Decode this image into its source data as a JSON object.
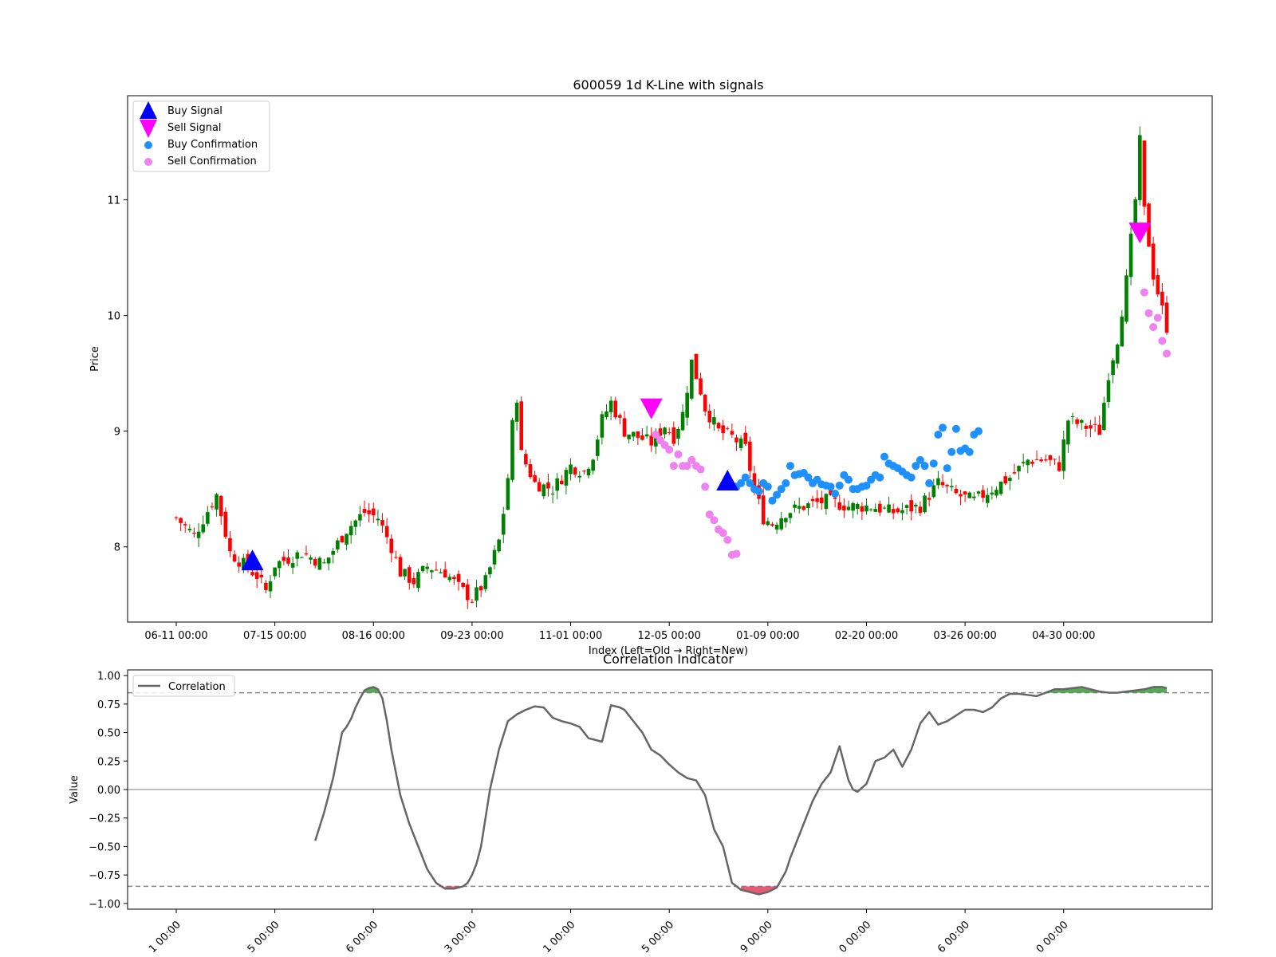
{
  "chart_data": [
    {
      "type": "candlestick",
      "title": "600059 1d K-Line with signals",
      "xlabel": "Index (Left=Old → Right=New)",
      "ylabel": "Price",
      "ylim": [
        7.35,
        11.9
      ],
      "yticks": [
        8,
        9,
        10,
        11
      ],
      "xtick_labels": [
        "06-11 00:00",
        "07-15 00:00",
        "08-16 00:00",
        "09-23 00:00",
        "11-01 00:00",
        "12-05 00:00",
        "01-09 00:00",
        "02-20 00:00",
        "03-26 00:00",
        "04-30 00:00"
      ],
      "xtick_index": [
        0,
        22,
        44,
        66,
        88,
        110,
        132,
        154,
        176,
        198
      ],
      "n_bars": 222,
      "legend": {
        "position": "upper left",
        "entries": [
          "Buy Signal",
          "Sell Signal",
          "Buy Confirmation",
          "Sell Confirmation"
        ]
      },
      "colors": {
        "up": "#008000",
        "down": "#ff0000",
        "buy_signal": "#0000ff",
        "sell_signal": "#ff00ff",
        "buy_confirmation": "#1e90ff",
        "sell_confirmation": "#ee82ee"
      },
      "close_anchors": [
        [
          0,
          8.25
        ],
        [
          4,
          8.1
        ],
        [
          9,
          8.45
        ],
        [
          12,
          7.95
        ],
        [
          18,
          7.75
        ],
        [
          20,
          7.62
        ],
        [
          22,
          7.85
        ],
        [
          28,
          7.95
        ],
        [
          33,
          7.85
        ],
        [
          38,
          8.15
        ],
        [
          42,
          8.3
        ],
        [
          45,
          8.25
        ],
        [
          48,
          8.0
        ],
        [
          50,
          7.78
        ],
        [
          53,
          7.7
        ],
        [
          56,
          7.83
        ],
        [
          60,
          7.78
        ],
        [
          63,
          7.65
        ],
        [
          66,
          7.55
        ],
        [
          69,
          7.7
        ],
        [
          72,
          8.05
        ],
        [
          73,
          8.3
        ],
        [
          74,
          8.6
        ],
        [
          75,
          9.05
        ],
        [
          76,
          9.3
        ],
        [
          77,
          8.8
        ],
        [
          80,
          8.55
        ],
        [
          84,
          8.5
        ],
        [
          88,
          8.7
        ],
        [
          91,
          8.65
        ],
        [
          93,
          8.8
        ],
        [
          95,
          9.1
        ],
        [
          97,
          9.25
        ],
        [
          100,
          9.0
        ],
        [
          103,
          8.95
        ],
        [
          106,
          8.9
        ],
        [
          109,
          9.05
        ],
        [
          111,
          8.95
        ],
        [
          113,
          9.15
        ],
        [
          115,
          9.6
        ],
        [
          117,
          9.35
        ],
        [
          118,
          9.2
        ],
        [
          121,
          9.0
        ],
        [
          124,
          8.95
        ],
        [
          127,
          8.85
        ],
        [
          129,
          8.5
        ],
        [
          131,
          8.25
        ],
        [
          133,
          8.2
        ],
        [
          136,
          8.3
        ],
        [
          140,
          8.35
        ],
        [
          145,
          8.4
        ],
        [
          150,
          8.35
        ],
        [
          155,
          8.35
        ],
        [
          160,
          8.3
        ],
        [
          166,
          8.35
        ],
        [
          170,
          8.55
        ],
        [
          174,
          8.45
        ],
        [
          178,
          8.4
        ],
        [
          182,
          8.5
        ],
        [
          186,
          8.6
        ],
        [
          190,
          8.75
        ],
        [
          194,
          8.75
        ],
        [
          197,
          8.7
        ],
        [
          199,
          9.1
        ],
        [
          202,
          9.05
        ],
        [
          206,
          9.0
        ],
        [
          208,
          9.5
        ],
        [
          210,
          9.8
        ],
        [
          212,
          10.3
        ],
        [
          214,
          11.0
        ],
        [
          215,
          11.5
        ],
        [
          216,
          10.9
        ],
        [
          218,
          10.35
        ],
        [
          220,
          10.05
        ],
        [
          221,
          9.9
        ]
      ],
      "buy_signals": [
        [
          17,
          7.88
        ],
        [
          123,
          8.57
        ]
      ],
      "sell_signals": [
        [
          106,
          9.2
        ],
        [
          215,
          10.72
        ]
      ],
      "buy_confirmation": [
        [
          125,
          8.52
        ],
        [
          126,
          8.55
        ],
        [
          127,
          8.6
        ],
        [
          128,
          8.55
        ],
        [
          129,
          8.5
        ],
        [
          130,
          8.48
        ],
        [
          131,
          8.55
        ],
        [
          132,
          8.52
        ],
        [
          133,
          8.4
        ],
        [
          134,
          8.45
        ],
        [
          135,
          8.5
        ],
        [
          136,
          8.55
        ],
        [
          137,
          8.7
        ],
        [
          138,
          8.62
        ],
        [
          139,
          8.63
        ],
        [
          140,
          8.64
        ],
        [
          141,
          8.6
        ],
        [
          142,
          8.55
        ],
        [
          143,
          8.58
        ],
        [
          144,
          8.54
        ],
        [
          145,
          8.53
        ],
        [
          146,
          8.52
        ],
        [
          147,
          8.46
        ],
        [
          148,
          8.53
        ],
        [
          149,
          8.62
        ],
        [
          150,
          8.58
        ],
        [
          151,
          8.5
        ],
        [
          152,
          8.5
        ],
        [
          153,
          8.52
        ],
        [
          154,
          8.53
        ],
        [
          155,
          8.58
        ],
        [
          156,
          8.62
        ],
        [
          157,
          8.6
        ],
        [
          158,
          8.78
        ],
        [
          159,
          8.72
        ],
        [
          160,
          8.7
        ],
        [
          161,
          8.68
        ],
        [
          162,
          8.65
        ],
        [
          163,
          8.62
        ],
        [
          164,
          8.6
        ],
        [
          165,
          8.7
        ],
        [
          166,
          8.75
        ],
        [
          167,
          8.7
        ],
        [
          168,
          8.55
        ],
        [
          169,
          8.72
        ],
        [
          170,
          8.97
        ],
        [
          171,
          9.03
        ],
        [
          172,
          8.68
        ],
        [
          173,
          8.82
        ],
        [
          174,
          9.02
        ],
        [
          175,
          8.83
        ],
        [
          176,
          8.85
        ],
        [
          177,
          8.82
        ],
        [
          178,
          8.97
        ],
        [
          179,
          9.0
        ]
      ],
      "sell_confirmation": [
        [
          107,
          8.97
        ],
        [
          108,
          8.92
        ],
        [
          109,
          8.88
        ],
        [
          110,
          8.84
        ],
        [
          111,
          8.7
        ],
        [
          112,
          8.8
        ],
        [
          113,
          8.7
        ],
        [
          114,
          8.7
        ],
        [
          115,
          8.75
        ],
        [
          116,
          8.7
        ],
        [
          117,
          8.67
        ],
        [
          118,
          8.52
        ],
        [
          119,
          8.28
        ],
        [
          120,
          8.23
        ],
        [
          121,
          8.15
        ],
        [
          122,
          8.12
        ],
        [
          123,
          8.06
        ],
        [
          124,
          7.93
        ],
        [
          125,
          7.94
        ],
        [
          216,
          10.2
        ],
        [
          217,
          10.02
        ],
        [
          218,
          9.9
        ],
        [
          219,
          9.98
        ],
        [
          220,
          9.78
        ],
        [
          221,
          9.67
        ]
      ]
    },
    {
      "type": "line",
      "title": "Correlation Indicator",
      "ylabel": "Value",
      "ylim": [
        -1.05,
        1.05
      ],
      "yticks": [
        1.0,
        0.75,
        0.5,
        0.25,
        0.0,
        -0.25,
        -0.5,
        -0.75,
        -1.0
      ],
      "ytick_labels": [
        "1.00",
        "0.75",
        "0.50",
        "0.25",
        "0.00",
        "−0.25",
        "−0.50",
        "−0.75",
        "−1.00"
      ],
      "xtick_labels": [
        "1 00:00",
        "5 00:00",
        "6 00:00",
        "3 00:00",
        "1 00:00",
        "5 00:00",
        "9 00:00",
        "0 00:00",
        "6 00:00",
        "0 00:00"
      ],
      "thresholds": [
        0.85,
        -0.85
      ],
      "legend": {
        "position": "upper left",
        "entries": [
          "Correlation"
        ]
      },
      "colors": {
        "line": "#666666",
        "positive_fill": "#3a9a3a",
        "negative_fill": "#e0405e",
        "threshold": "#888888",
        "zero": "#aaaaaa"
      },
      "series": [
        {
          "name": "Correlation",
          "x": [
            31,
            33,
            35,
            37,
            38,
            39,
            40,
            41,
            42,
            43,
            44,
            45,
            46,
            47,
            48,
            50,
            52,
            54,
            56,
            58,
            60,
            62,
            64,
            65,
            66,
            67,
            68,
            70,
            72,
            74,
            76,
            78,
            80,
            82,
            84,
            86,
            88,
            90,
            92,
            95,
            97,
            99,
            100,
            101,
            102,
            104,
            106,
            108,
            110,
            112,
            114,
            116,
            118,
            120,
            122,
            124,
            126,
            128,
            130,
            132,
            134,
            136,
            137,
            138,
            139,
            140,
            142,
            144,
            146,
            148,
            150,
            151,
            152,
            154,
            156,
            158,
            160,
            162,
            164,
            166,
            168,
            170,
            172,
            174,
            176,
            178,
            180,
            182,
            184,
            186,
            188,
            190,
            192,
            194,
            196,
            198,
            200,
            202,
            204,
            206,
            208,
            210,
            212,
            214,
            216,
            218,
            220,
            221
          ],
          "y": [
            -0.45,
            -0.2,
            0.1,
            0.5,
            0.55,
            0.62,
            0.72,
            0.8,
            0.87,
            0.89,
            0.9,
            0.88,
            0.8,
            0.6,
            0.35,
            -0.05,
            -0.3,
            -0.5,
            -0.7,
            -0.82,
            -0.87,
            -0.87,
            -0.85,
            -0.82,
            -0.75,
            -0.65,
            -0.5,
            0.0,
            0.35,
            0.6,
            0.66,
            0.7,
            0.73,
            0.72,
            0.63,
            0.6,
            0.58,
            0.55,
            0.45,
            0.42,
            0.74,
            0.72,
            0.7,
            0.65,
            0.6,
            0.5,
            0.35,
            0.3,
            0.22,
            0.15,
            0.1,
            0.08,
            -0.05,
            -0.35,
            -0.5,
            -0.82,
            -0.88,
            -0.9,
            -0.92,
            -0.9,
            -0.86,
            -0.72,
            -0.6,
            -0.5,
            -0.4,
            -0.3,
            -0.1,
            0.05,
            0.15,
            0.38,
            0.08,
            0.0,
            -0.02,
            0.05,
            0.25,
            0.28,
            0.35,
            0.2,
            0.35,
            0.58,
            0.68,
            0.57,
            0.6,
            0.65,
            0.7,
            0.7,
            0.68,
            0.72,
            0.8,
            0.84,
            0.84,
            0.83,
            0.82,
            0.85,
            0.88,
            0.88,
            0.89,
            0.9,
            0.88,
            0.86,
            0.85,
            0.85,
            0.86,
            0.87,
            0.88,
            0.9,
            0.9,
            0.89
          ]
        }
      ]
    }
  ]
}
